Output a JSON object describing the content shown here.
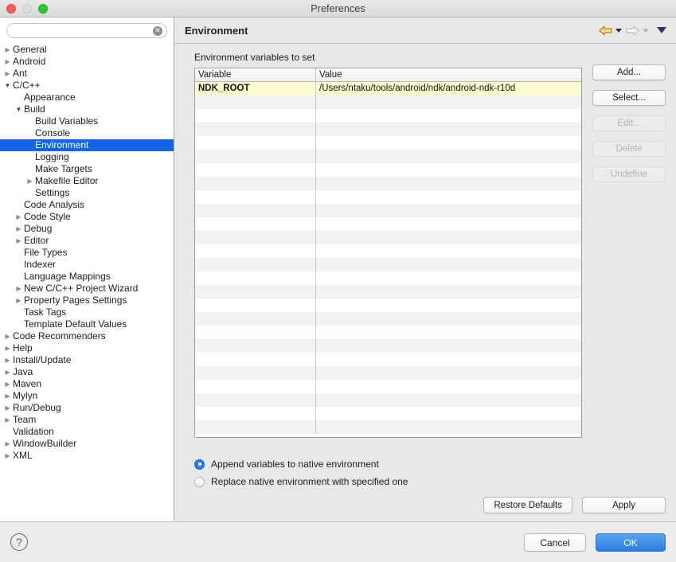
{
  "window": {
    "title": "Preferences",
    "traffic_lights": [
      "close-button",
      "minimize-button",
      "zoom-button"
    ]
  },
  "sidebar": {
    "search": {
      "value": "",
      "placeholder": "",
      "clear_glyph": "✕"
    },
    "items": [
      {
        "label": "General",
        "indent": 0,
        "twisty": "collapsed",
        "selected": false
      },
      {
        "label": "Android",
        "indent": 0,
        "twisty": "collapsed",
        "selected": false
      },
      {
        "label": "Ant",
        "indent": 0,
        "twisty": "collapsed",
        "selected": false
      },
      {
        "label": "C/C++",
        "indent": 0,
        "twisty": "expanded",
        "selected": false
      },
      {
        "label": "Appearance",
        "indent": 1,
        "twisty": "none",
        "selected": false
      },
      {
        "label": "Build",
        "indent": 1,
        "twisty": "expanded",
        "selected": false
      },
      {
        "label": "Build Variables",
        "indent": 2,
        "twisty": "none",
        "selected": false
      },
      {
        "label": "Console",
        "indent": 2,
        "twisty": "none",
        "selected": false
      },
      {
        "label": "Environment",
        "indent": 2,
        "twisty": "none",
        "selected": true
      },
      {
        "label": "Logging",
        "indent": 2,
        "twisty": "none",
        "selected": false
      },
      {
        "label": "Make Targets",
        "indent": 2,
        "twisty": "none",
        "selected": false
      },
      {
        "label": "Makefile Editor",
        "indent": 2,
        "twisty": "collapsed",
        "selected": false
      },
      {
        "label": "Settings",
        "indent": 2,
        "twisty": "none",
        "selected": false
      },
      {
        "label": "Code Analysis",
        "indent": 1,
        "twisty": "none",
        "selected": false
      },
      {
        "label": "Code Style",
        "indent": 1,
        "twisty": "collapsed",
        "selected": false
      },
      {
        "label": "Debug",
        "indent": 1,
        "twisty": "collapsed",
        "selected": false
      },
      {
        "label": "Editor",
        "indent": 1,
        "twisty": "collapsed",
        "selected": false
      },
      {
        "label": "File Types",
        "indent": 1,
        "twisty": "none",
        "selected": false
      },
      {
        "label": "Indexer",
        "indent": 1,
        "twisty": "none",
        "selected": false
      },
      {
        "label": "Language Mappings",
        "indent": 1,
        "twisty": "none",
        "selected": false
      },
      {
        "label": "New C/C++ Project Wizard",
        "indent": 1,
        "twisty": "collapsed",
        "selected": false
      },
      {
        "label": "Property Pages Settings",
        "indent": 1,
        "twisty": "collapsed",
        "selected": false
      },
      {
        "label": "Task Tags",
        "indent": 1,
        "twisty": "none",
        "selected": false
      },
      {
        "label": "Template Default Values",
        "indent": 1,
        "twisty": "none",
        "selected": false
      },
      {
        "label": "Code Recommenders",
        "indent": 0,
        "twisty": "collapsed",
        "selected": false
      },
      {
        "label": "Help",
        "indent": 0,
        "twisty": "collapsed",
        "selected": false
      },
      {
        "label": "Install/Update",
        "indent": 0,
        "twisty": "collapsed",
        "selected": false
      },
      {
        "label": "Java",
        "indent": 0,
        "twisty": "collapsed",
        "selected": false
      },
      {
        "label": "Maven",
        "indent": 0,
        "twisty": "collapsed",
        "selected": false
      },
      {
        "label": "Mylyn",
        "indent": 0,
        "twisty": "collapsed",
        "selected": false
      },
      {
        "label": "Run/Debug",
        "indent": 0,
        "twisty": "collapsed",
        "selected": false
      },
      {
        "label": "Team",
        "indent": 0,
        "twisty": "collapsed",
        "selected": false
      },
      {
        "label": "Validation",
        "indent": 0,
        "twisty": "none",
        "selected": false
      },
      {
        "label": "WindowBuilder",
        "indent": 0,
        "twisty": "collapsed",
        "selected": false
      },
      {
        "label": "XML",
        "indent": 0,
        "twisty": "collapsed",
        "selected": false
      }
    ]
  },
  "content": {
    "title": "Environment",
    "nav": {
      "back_icon": "back-arrow-icon",
      "forward_icon": "forward-arrow-icon",
      "menu_icon": "view-menu-triangle-icon"
    },
    "section_label": "Environment variables to set",
    "table": {
      "columns": [
        "Variable",
        "Value"
      ],
      "rows": [
        {
          "variable": "NDK_ROOT",
          "value": "/Users/ntaku/tools/android/ndk/android-ndk-r10d",
          "highlighted": true
        }
      ],
      "empty_row_count": 25
    },
    "side_buttons": [
      {
        "label": "Add...",
        "enabled": true
      },
      {
        "label": "Select...",
        "enabled": true
      },
      {
        "label": "Edit...",
        "enabled": false
      },
      {
        "label": "Delete",
        "enabled": false
      },
      {
        "label": "Undefine",
        "enabled": false
      }
    ],
    "radios": [
      {
        "label": "Append variables to native environment",
        "selected": true
      },
      {
        "label": "Replace native environment with specified one",
        "selected": false
      }
    ],
    "footer_buttons": [
      {
        "label": "Restore Defaults"
      },
      {
        "label": "Apply"
      }
    ]
  },
  "bottom_bar": {
    "help_glyph": "?",
    "cancel_label": "Cancel",
    "ok_label": "OK"
  },
  "colors": {
    "selection_blue": "#1464e6",
    "highlight_yellow": "#fcfbcf",
    "ok_blue": "#2a7be0",
    "panel_gray": "#e8e8e8"
  }
}
